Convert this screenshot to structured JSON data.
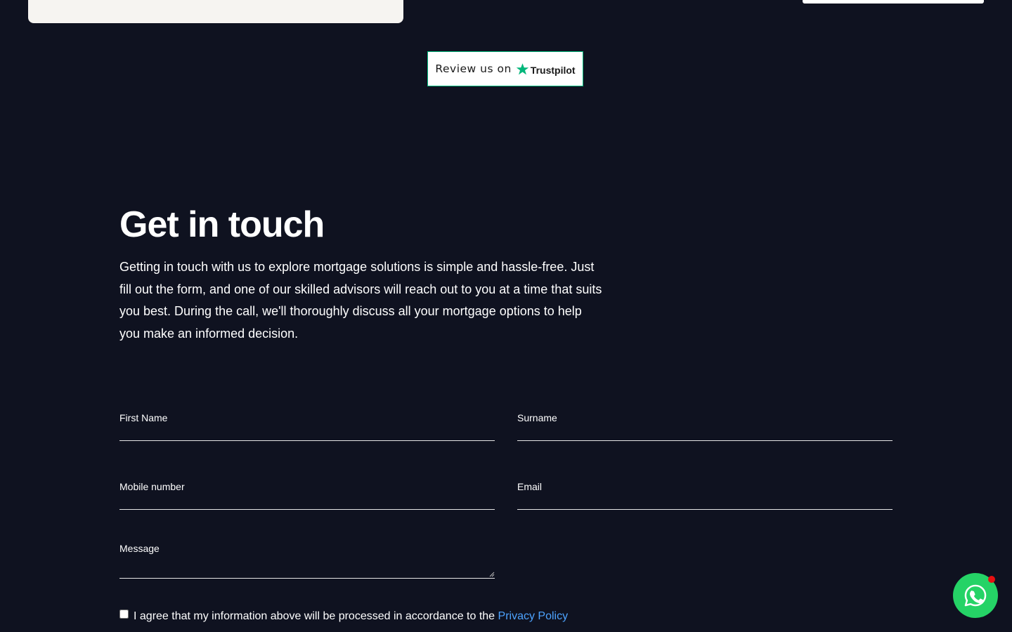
{
  "trustpilot": {
    "review_text": "Review us on",
    "brand": "Trustpilot",
    "star_color": "#00b67a"
  },
  "contact": {
    "heading": "Get in touch",
    "intro": "Getting in touch with us to explore mortgage solutions is simple and hassle-free. Just fill out the form, and one of our skilled advisors will reach out to you at a time that suits you best. During the call, we'll thoroughly discuss all your mortgage options to help you make an informed decision."
  },
  "form": {
    "first_name_label": "First Name",
    "surname_label": "Surname",
    "mobile_label": "Mobile number",
    "email_label": "Email",
    "message_label": "Message",
    "consent_text": "I agree that my information above will be processed in accordance to the",
    "privacy_link": "Privacy Policy"
  },
  "whatsapp": {
    "icon": "whatsapp-icon",
    "color": "#25d366",
    "badge_color": "#e80f10"
  }
}
